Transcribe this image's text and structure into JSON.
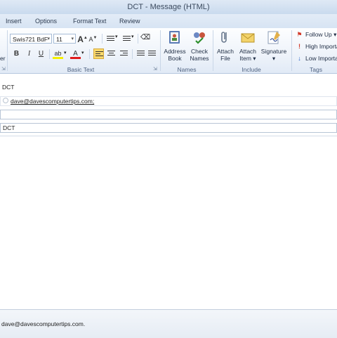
{
  "window": {
    "title": "DCT - Message (HTML)"
  },
  "tabs": [
    "Insert",
    "Options",
    "Format Text",
    "Review"
  ],
  "ribbon": {
    "clipboard_fragment": "er",
    "basic_text": {
      "label": "Basic Text",
      "font_name": "Swis721 BdF",
      "font_size": "11",
      "grow_font": "A",
      "shrink_font": "A",
      "bold": "B",
      "italic": "I",
      "underline": "U",
      "font_color": "A"
    },
    "names": {
      "label": "Names",
      "address_book": [
        "Address",
        "Book"
      ],
      "check_names": [
        "Check",
        "Names"
      ]
    },
    "include": {
      "label": "Include",
      "attach_file": [
        "Attach",
        "File"
      ],
      "attach_item": [
        "Attach",
        "Item ▾"
      ],
      "signature": [
        "Signature",
        "▾"
      ]
    },
    "tags": {
      "label": "Tags",
      "follow_up": "Follow Up ▾",
      "high_importance": "High Importance",
      "low_importance": "Low Importance"
    }
  },
  "header": {
    "from_label": "DCT",
    "to_value": "dave@davescomputertips.com;",
    "cc_value": "",
    "subject_value": "DCT"
  },
  "status": {
    "text": "dave@davescomputertips.com."
  },
  "colors": {
    "accent": "#fbd96c",
    "ribbon": "#e1eaf6",
    "link": "#1e3c8c"
  }
}
